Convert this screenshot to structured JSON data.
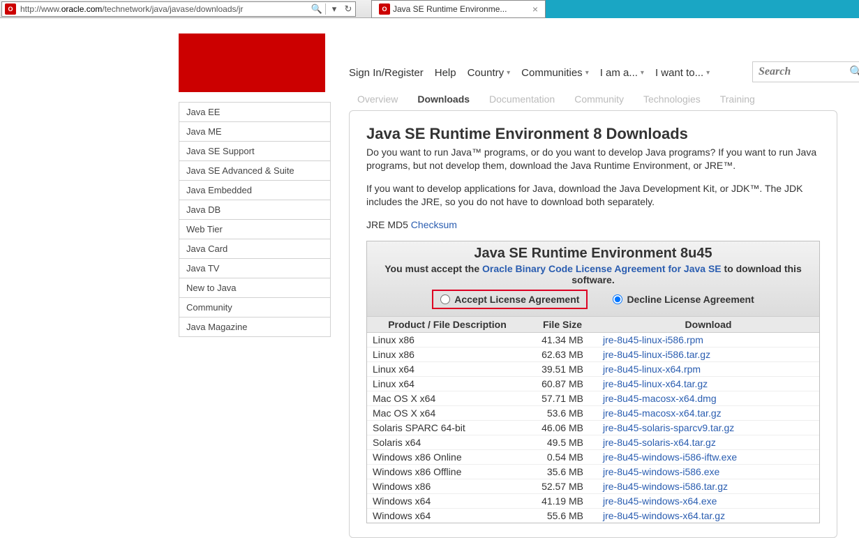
{
  "browser": {
    "url_prefix": "http://www.",
    "url_host": "oracle.com",
    "url_path": "/technetwork/java/javase/downloads/jr",
    "tab_title": "Java SE Runtime Environme..."
  },
  "topnav": {
    "signin": "Sign In/Register",
    "help": "Help",
    "country": "Country",
    "communities": "Communities",
    "iam": "I am a...",
    "iwant": "I want to...",
    "search_placeholder": "Search"
  },
  "tabs": {
    "overview": "Overview",
    "downloads": "Downloads",
    "documentation": "Documentation",
    "community": "Community",
    "technologies": "Technologies",
    "training": "Training"
  },
  "sidebar": {
    "items": [
      "Java EE",
      "Java ME",
      "Java SE Support",
      "Java SE Advanced & Suite",
      "Java Embedded",
      "Java DB",
      "Web Tier",
      "Java Card",
      "Java TV",
      "New to Java",
      "Community",
      "Java Magazine"
    ]
  },
  "page": {
    "title": "Java SE Runtime Environment 8 Downloads",
    "para1": "Do you want to run Java™ programs, or do you want to develop Java programs? If you want to run Java programs, but not develop them, download the Java Runtime Environment, or JRE™.",
    "para2": "If you want to develop applications for Java, download the Java Development Kit, or JDK™. The JDK includes the JRE, so you do not have to download both separately.",
    "md5_label": "JRE MD5 ",
    "md5_link": "Checksum"
  },
  "dlbox": {
    "heading": "Java SE Runtime Environment 8u45",
    "must_pre": "You must accept the ",
    "must_link": "Oracle Binary Code License Agreement for Java SE",
    "must_post": " to download this software.",
    "accept": "Accept License Agreement",
    "decline": "Decline License Agreement",
    "th_product": "Product / File Description",
    "th_size": "File Size",
    "th_download": "Download",
    "rows": [
      {
        "prod": "Linux x86",
        "size": "41.34 MB",
        "file": "jre-8u45-linux-i586.rpm"
      },
      {
        "prod": "Linux x86",
        "size": "62.63 MB",
        "file": "jre-8u45-linux-i586.tar.gz"
      },
      {
        "prod": "Linux x64",
        "size": "39.51 MB",
        "file": "jre-8u45-linux-x64.rpm"
      },
      {
        "prod": "Linux x64",
        "size": "60.87 MB",
        "file": "jre-8u45-linux-x64.tar.gz"
      },
      {
        "prod": "Mac OS X x64",
        "size": "57.71 MB",
        "file": "jre-8u45-macosx-x64.dmg"
      },
      {
        "prod": "Mac OS X x64",
        "size": "53.6 MB",
        "file": "jre-8u45-macosx-x64.tar.gz"
      },
      {
        "prod": "Solaris SPARC 64-bit",
        "size": "46.06 MB",
        "file": "jre-8u45-solaris-sparcv9.tar.gz"
      },
      {
        "prod": "Solaris x64",
        "size": "49.5 MB",
        "file": "jre-8u45-solaris-x64.tar.gz"
      },
      {
        "prod": "Windows x86 Online",
        "size": "0.54 MB",
        "file": "jre-8u45-windows-i586-iftw.exe"
      },
      {
        "prod": "Windows x86 Offline",
        "size": "35.6 MB",
        "file": "jre-8u45-windows-i586.exe"
      },
      {
        "prod": "Windows x86",
        "size": "52.57 MB",
        "file": "jre-8u45-windows-i586.tar.gz"
      },
      {
        "prod": "Windows x64",
        "size": "41.19 MB",
        "file": "jre-8u45-windows-x64.exe"
      },
      {
        "prod": "Windows x64",
        "size": "55.6 MB",
        "file": "jre-8u45-windows-x64.tar.gz"
      }
    ]
  }
}
